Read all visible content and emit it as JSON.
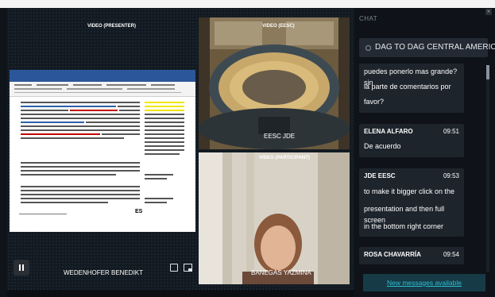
{
  "presenter_tile": {
    "label": "VIDEO (PRESENTER)",
    "name": "WEDENHOFER BENEDIKT",
    "document_language_badge": "ES"
  },
  "room_tile": {
    "label": "VIDEO (EESC)",
    "caption": "EESC JDE"
  },
  "participant_tile": {
    "label": "VIDEO (PARTICIPANT)",
    "name": "BANEGAS YAZMINA"
  },
  "chat": {
    "title": "CHAT",
    "close_symbol": "×",
    "channel_name": "DAG TO DAG CENTRAL AMERICA J...",
    "messages": [
      {
        "text_lines": [
          "puedes ponerlo mas grande? sin",
          "la parte de comentarios por",
          "favor?"
        ]
      },
      {
        "author": "ELENA ALFARO",
        "time": "09:51",
        "text_lines": [
          "De acuerdo"
        ]
      },
      {
        "author": "JDE EESC",
        "time": "09:53",
        "text_lines": [
          "to make it bigger click on the",
          "presentation and then full screen",
          "in the bottom right corner"
        ]
      },
      {
        "author": "ROSA CHAVARRÍA",
        "time": "09:54",
        "text_lines": []
      }
    ],
    "new_messages_link": "New messages available"
  },
  "icons": {
    "pause": "pause-icon",
    "fullscreen": "fullscreen-icon",
    "pip": "picture-in-picture-icon",
    "channel": "channel-dot-icon",
    "close": "close-icon"
  },
  "colors": {
    "app_background": "#0b0f14",
    "chat_background": "#0f1319",
    "message_bubble": "#1d242c",
    "link_accent": "#2bbfd6",
    "word_ribbon_blue": "#2b579a"
  }
}
